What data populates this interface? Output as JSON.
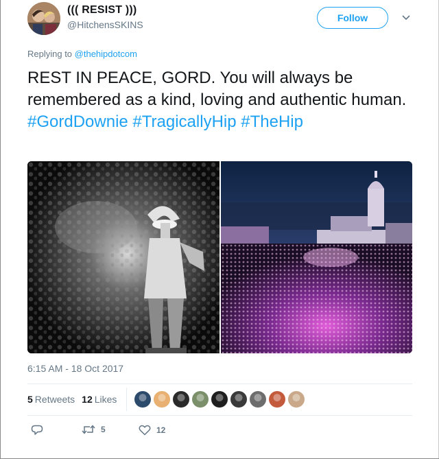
{
  "user": {
    "display_name": "((( RESIST )))",
    "handle": "@HitchensSKINS"
  },
  "follow_label": "Follow",
  "reply_context": {
    "prefix": "Replying to ",
    "mention": "@thehipdotcom"
  },
  "tweet": {
    "text": "REST IN PEACE, GORD. You will always be remembered as a kind, loving and authentic human.",
    "hashtags": [
      "#GordDownie",
      "#TragicallyHip",
      "#TheHip"
    ]
  },
  "media": {
    "photos": [
      "concert-performer-photo",
      "crowd-city-hall-photo"
    ]
  },
  "timestamp": "6:15 AM - 18 Oct 2017",
  "stats": {
    "retweets_count": "5",
    "retweets_label": "Retweets",
    "likes_count": "12",
    "likes_label": "Likes"
  },
  "likers": [
    {
      "color": "#2c4a6b"
    },
    {
      "color": "#e8b071"
    },
    {
      "color": "#2a2a2a"
    },
    {
      "color": "#7a8f6a"
    },
    {
      "color": "#1f1f1f"
    },
    {
      "color": "#3a3a3a"
    },
    {
      "color": "#6d6d6d"
    },
    {
      "color": "#c45a3c"
    },
    {
      "color": "#c9a98a"
    }
  ],
  "actions": {
    "reply_icon": "reply-icon",
    "retweet_icon": "retweet-icon",
    "retweet_count": "5",
    "like_icon": "heart-icon",
    "like_count": "12"
  },
  "colors": {
    "accent": "#1da1f2",
    "secondary_text": "#657786",
    "primary_text": "#14171a"
  }
}
